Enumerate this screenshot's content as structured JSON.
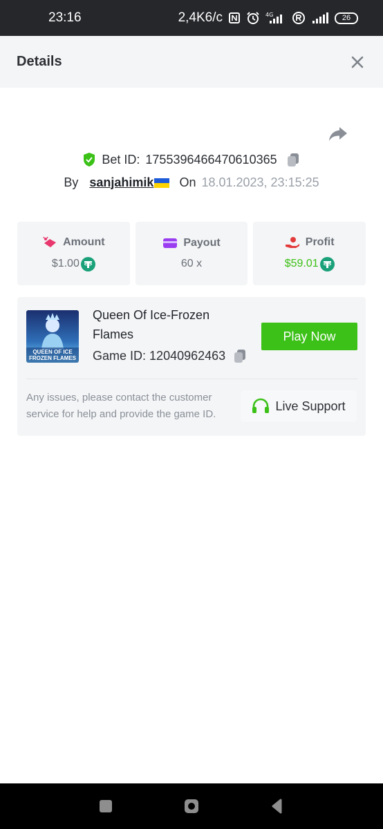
{
  "status_bar": {
    "time": "23:16",
    "network_speed": "2,4K6/c",
    "network_type": "4G",
    "battery": "26",
    "icons": [
      "nfc-icon",
      "alarm-icon",
      "signal-icon",
      "registered-icon",
      "signal-icon",
      "battery-icon"
    ]
  },
  "header": {
    "title": "Details",
    "close_icon": "close-icon"
  },
  "bet": {
    "label": "Bet ID:",
    "id": "1755396466470610365",
    "by_label": "By",
    "username": "sanjahimik",
    "on_label": "On",
    "datetime": "18.01.2023, 23:15:25"
  },
  "stats": {
    "amount": {
      "label": "Amount",
      "value": "$1.00",
      "icon": "bet-amount-icon"
    },
    "payout": {
      "label": "Payout",
      "value": "60 x",
      "icon": "card-icon"
    },
    "profit": {
      "label": "Profit",
      "value": "$59.01",
      "icon": "hand-coin-icon"
    }
  },
  "game": {
    "title": "Queen Of Ice-Frozen Flames",
    "thumb_text_line1": "QUEEN OF ICE",
    "thumb_text_line2": "FROZEN FLAMES",
    "id_label": "Game ID:",
    "id": "12040962463",
    "play_label": "Play Now",
    "issue_text": "Any issues, please contact the customer service for help and provide the game ID.",
    "support_label": "Live Support"
  },
  "colors": {
    "accent_green": "#3bc117",
    "tether": "#1aa179",
    "panel": "#f4f5f6",
    "status_bar": "#26272b"
  }
}
